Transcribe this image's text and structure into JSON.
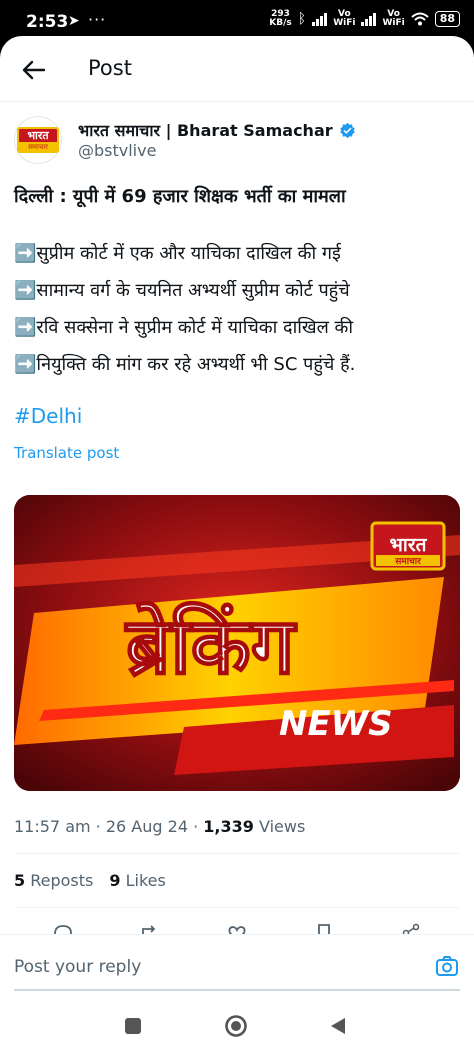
{
  "status_bar": {
    "time": "2:53",
    "speed_value": "293",
    "speed_unit": "KB/s",
    "vo_label": "Vo",
    "wifi_label": "WiFi",
    "battery": "88"
  },
  "topbar": {
    "title": "Post"
  },
  "author": {
    "name": "भारत समाचार | Bharat Samachar",
    "handle": "@bstvlive",
    "logo_line1": "भारत",
    "logo_line2": "समाचार"
  },
  "tweet": {
    "title": "दिल्ली : यूपी में 69 हजार शिक्षक भर्ती का मामला",
    "bullets": [
      "➡️सुप्रीम कोर्ट में एक और याचिका दाखिल की गई",
      "➡️सामान्य वर्ग के चयनित अभ्यर्थी सुप्रीम कोर्ट पहुंचे",
      "➡️रवि सक्सेना ने सुप्रीम कोर्ट में याचिका दाखिल की",
      "➡️नियुक्ति की मांग कर रहे अभ्यर्थी भी SC पहुंचे हैं."
    ],
    "hashtag": "#Delhi",
    "translate": "Translate post"
  },
  "media": {
    "breaking_text": "ब्रेकिंग",
    "news_text": "NEWS",
    "logo_line1": "भारत",
    "logo_line2": "समाचार"
  },
  "meta": {
    "time": "11:57 am",
    "date": "26 Aug 24",
    "views_count": "1,339",
    "views_label": "Views"
  },
  "stats": {
    "reposts_count": "5",
    "reposts_label": "Reposts",
    "likes_count": "9",
    "likes_label": "Likes"
  },
  "reply": {
    "placeholder": "Post your reply"
  },
  "colors": {
    "accent": "#1d9bf0",
    "secondary_text": "#536471",
    "brand_red": "#c4161c"
  }
}
